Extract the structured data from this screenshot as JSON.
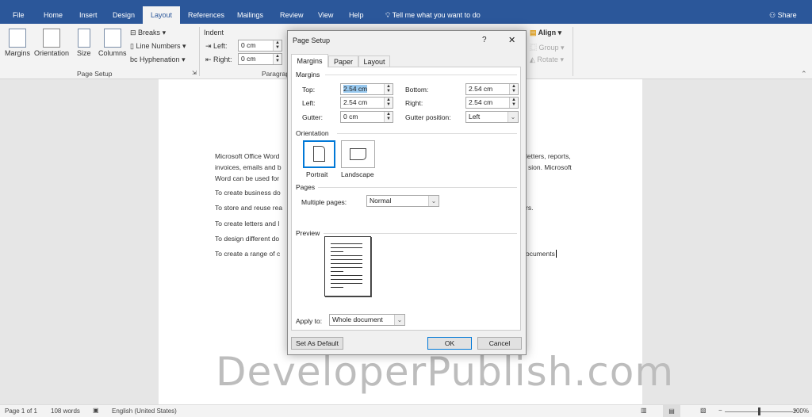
{
  "ribbon_tabs": [
    "File",
    "Home",
    "Insert",
    "Design",
    "Layout",
    "References",
    "Mailings",
    "Review",
    "View",
    "Help"
  ],
  "active_tab": "Layout",
  "tell_me": "Tell me what you want to do",
  "share": "Share",
  "ribbon": {
    "margins": "Margins",
    "orientation": "Orientation",
    "size": "Size",
    "columns": "Columns",
    "breaks": "Breaks",
    "line_numbers": "Line Numbers",
    "hyphenation": "Hyphenation",
    "page_setup_group": "Page Setup",
    "indent": "Indent",
    "left_label": "Left:",
    "right_label": "Right:",
    "left_value": "0 cm",
    "right_value": "0 cm",
    "paragraph_group": "Paragraph",
    "align": "Align",
    "group": "Group",
    "rotate": "Rotate"
  },
  "document": {
    "lines_left": [
      "Microsoft Office Word",
      "invoices, emails and b",
      "Word can be used for",
      "To create business do",
      "To store and reuse rea",
      "To create letters and l",
      "To design different do",
      "To create a range of c"
    ],
    "lines_right": [
      "letters, reports,",
      "sion. Microsoft",
      "",
      "",
      "rs.",
      "",
      "",
      "ocuments"
    ]
  },
  "watermark": "DeveloperPublish.com",
  "status": {
    "page": "Page 1 of 1",
    "words": "108 words",
    "language": "English (United States)",
    "zoom": "100%",
    "zoom_percent": 100
  },
  "dialog": {
    "title": "Page Setup",
    "help": "?",
    "close": "✕",
    "tabs": [
      "Margins",
      "Paper",
      "Layout"
    ],
    "active_tab": "Margins",
    "margins_section": "Margins",
    "top_label": "Top:",
    "top_value": "2.54 cm",
    "bottom_label": "Bottom:",
    "bottom_value": "2.54 cm",
    "left_label": "Left:",
    "left_value": "2.54 cm",
    "right_label": "Right:",
    "right_value": "2.54 cm",
    "gutter_label": "Gutter:",
    "gutter_value": "0 cm",
    "gutter_pos_label": "Gutter position:",
    "gutter_pos_value": "Left",
    "orientation_section": "Orientation",
    "portrait": "Portrait",
    "landscape": "Landscape",
    "selected_orientation": "Portrait",
    "pages_section": "Pages",
    "multiple_pages_label": "Multiple pages:",
    "multiple_pages_value": "Normal",
    "preview_section": "Preview",
    "apply_to_label": "Apply to:",
    "apply_to_value": "Whole document",
    "set_default": "Set As Default",
    "ok": "OK",
    "cancel": "Cancel"
  },
  "colors": {
    "accent": "#2b579a",
    "selection": "#99c9ef",
    "focus": "#0078d7"
  }
}
